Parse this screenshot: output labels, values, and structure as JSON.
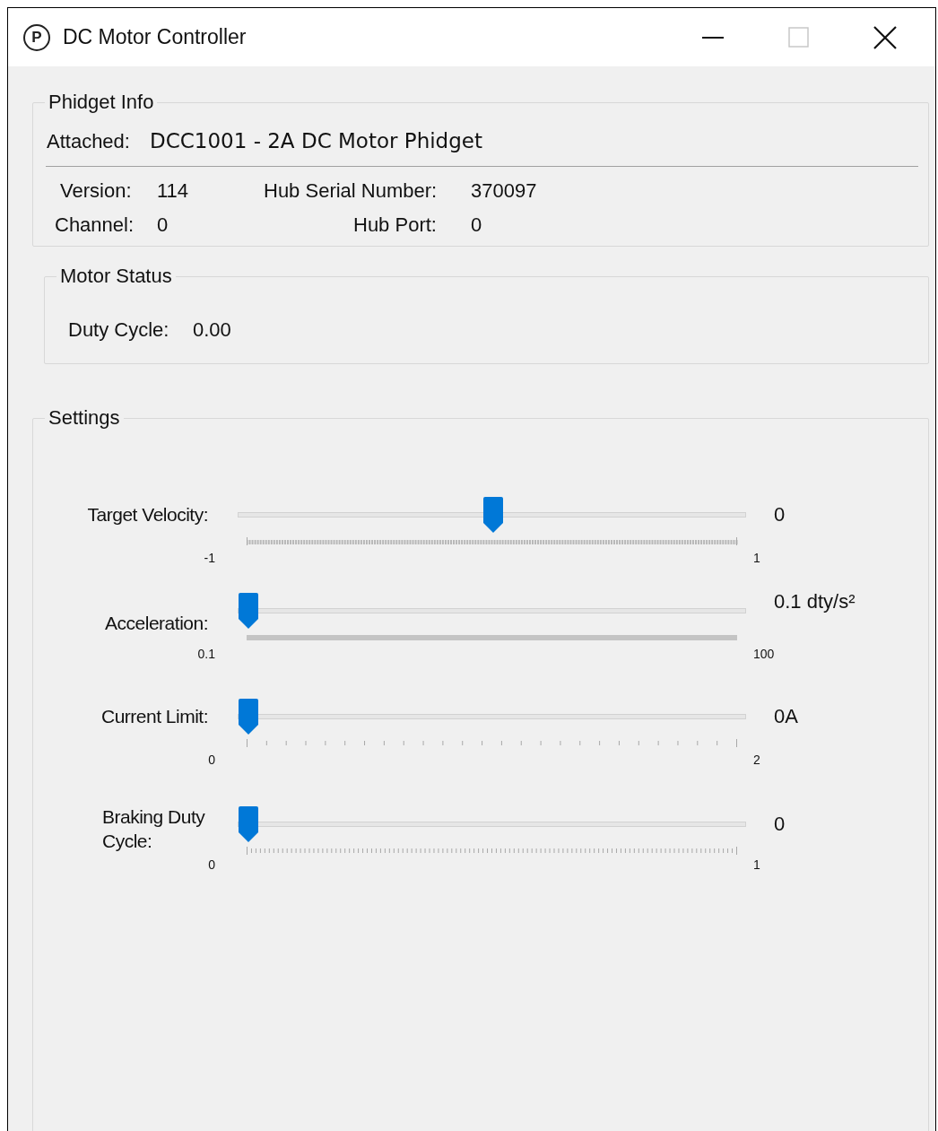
{
  "window": {
    "icon_letter": "P",
    "title": "DC Motor Controller",
    "controls": [
      {
        "kind": "minimize",
        "disabled": false
      },
      {
        "kind": "maximize",
        "disabled": true
      },
      {
        "kind": "close",
        "disabled": false
      }
    ]
  },
  "phidget_info": {
    "title": "Phidget Info",
    "attached_label": "Attached:",
    "attached_value": "DCC1001 - 2A DC Motor Phidget",
    "fields": [
      {
        "label": "Version:",
        "value": "114"
      },
      {
        "label": "Hub Serial Number:",
        "value": "370097"
      },
      {
        "label": "Channel:",
        "value": "0"
      },
      {
        "label": "Hub Port:",
        "value": "0"
      }
    ]
  },
  "motor_status": {
    "title": "Motor Status",
    "label": "Duty Cycle:",
    "value": "0.00"
  },
  "settings": {
    "title": "Settings",
    "sliders": [
      {
        "label": "Target Velocity:",
        "level": 0.5,
        "value": "0",
        "min": "-1",
        "max": "1",
        "kind": "dashed"
      },
      {
        "label": "Acceleration:",
        "level": 0,
        "value": "0.1 dty/s²",
        "min": "0.1",
        "max": "100",
        "kind": "solid"
      },
      {
        "label": "Current Limit:",
        "level": 0,
        "value": "0A",
        "min": "0",
        "max": "2",
        "kind": "sparse"
      },
      {
        "label": "Braking Duty Cycle:",
        "level": 0,
        "value": "0",
        "min": "0",
        "max": "1",
        "kind": "fine"
      }
    ]
  }
}
